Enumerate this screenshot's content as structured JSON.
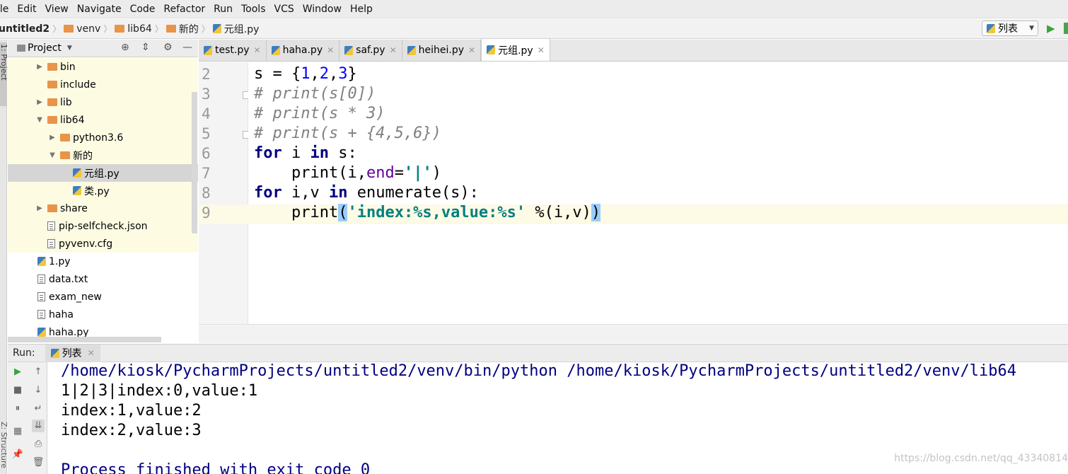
{
  "menu": [
    "ile",
    "Edit",
    "View",
    "Navigate",
    "Code",
    "Refactor",
    "Run",
    "Tools",
    "VCS",
    "Window",
    "Help"
  ],
  "breadcrumb": [
    {
      "label": "untitled2",
      "icon": "project-folder-icon"
    },
    {
      "label": "venv",
      "icon": "folder-icon"
    },
    {
      "label": "lib64",
      "icon": "folder-icon"
    },
    {
      "label": "新的",
      "icon": "folder-icon"
    },
    {
      "label": "元组.py",
      "icon": "python-file-icon"
    }
  ],
  "run_config": {
    "label": "列表"
  },
  "project_panel": {
    "title": "Project"
  },
  "tree": [
    {
      "label": "bin",
      "type": "folder",
      "arrow": "▶"
    },
    {
      "label": "include",
      "type": "folder",
      "arrow": ""
    },
    {
      "label": "lib",
      "type": "folder",
      "arrow": "▶"
    },
    {
      "label": "lib64",
      "type": "folder",
      "arrow": "▼"
    },
    {
      "label": "python3.6",
      "type": "folder",
      "arrow": "▶"
    },
    {
      "label": "新的",
      "type": "folder",
      "arrow": "▼"
    },
    {
      "label": "元组.py",
      "type": "py",
      "arrow": ""
    },
    {
      "label": "类.py",
      "type": "py",
      "arrow": ""
    },
    {
      "label": "share",
      "type": "folder",
      "arrow": "▶"
    },
    {
      "label": "pip-selfcheck.json",
      "type": "file",
      "arrow": ""
    },
    {
      "label": "pyvenv.cfg",
      "type": "file",
      "arrow": ""
    },
    {
      "label": "1.py",
      "type": "py",
      "arrow": ""
    },
    {
      "label": "data.txt",
      "type": "file",
      "arrow": ""
    },
    {
      "label": "exam_new",
      "type": "file",
      "arrow": ""
    },
    {
      "label": "haha",
      "type": "file",
      "arrow": ""
    },
    {
      "label": "haha.py",
      "type": "py",
      "arrow": ""
    }
  ],
  "tabs": [
    "test.py",
    "haha.py",
    "saf.py",
    "heihei.py",
    "元组.py"
  ],
  "active_tab": "元组.py",
  "line_numbers": [
    "2",
    "3",
    "4",
    "5",
    "6",
    "7",
    "8",
    "9"
  ],
  "code": {
    "l2": [
      "s = {",
      "1",
      ",",
      "2",
      ",",
      "3",
      "}"
    ],
    "l3": "# print(s[0])",
    "l4": "# print(s * 3)",
    "l5": "# print(s + {4,5,6})",
    "l6": [
      "for",
      " i ",
      "in",
      " s:"
    ],
    "l7": [
      "    print(i,",
      "end",
      "=",
      "'|'",
      ")"
    ],
    "l8": [
      "for",
      " i,v ",
      "in",
      " enumerate(s):"
    ],
    "l9": [
      "    print",
      "(",
      "'index:%s,value:%s'",
      " %(i,v)",
      ")"
    ]
  },
  "run_panel": {
    "label": "Run:",
    "tab": "列表"
  },
  "console": [
    "/home/kiosk/PycharmProjects/untitled2/venv/bin/python /home/kiosk/PycharmProjects/untitled2/venv/lib64",
    "1|2|3|index:0,value:1",
    "index:1,value:2",
    "index:2,value:3",
    "",
    "Process finished with exit code 0"
  ],
  "watermark": "https://blog.csdn.net/qq_43340814",
  "side_labels": {
    "project": "1: Project",
    "structure": "Z: Structure"
  }
}
